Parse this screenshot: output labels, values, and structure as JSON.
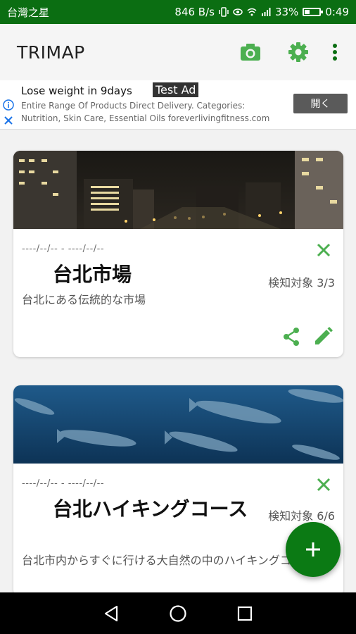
{
  "status_bar": {
    "carrier": "台灣之星",
    "network_speed": "846 B/s",
    "battery_percent": "33%",
    "battery_level": 0.33,
    "time": "0:49"
  },
  "app_bar": {
    "title": "TRIMAP",
    "actions": [
      "camera-icon",
      "gear-icon",
      "more-vert-icon"
    ]
  },
  "ad": {
    "title": "Lose weight in 9days",
    "badge": "Test Ad",
    "description": "Entire Range Of Products Direct Delivery. Categories: Nutrition, Skin Care, Essential Oils foreverlivingfitness.com",
    "open_label": "開く"
  },
  "cards": [
    {
      "dates": "----/--/--  -  ----/--/--",
      "title": "台北市場",
      "count": "検知対象 3/3",
      "description": "台北にある伝統的な市場"
    },
    {
      "dates": "----/--/--  -  ----/--/--",
      "title": "台北ハイキングコース",
      "count": "検知対象 6/6",
      "description": "台北市内からすぐに行ける大自然の中のハイキングコース"
    }
  ],
  "colors": {
    "primary": "#0b6e12",
    "accent": "#4caf50",
    "fab": "#0b7a14"
  }
}
